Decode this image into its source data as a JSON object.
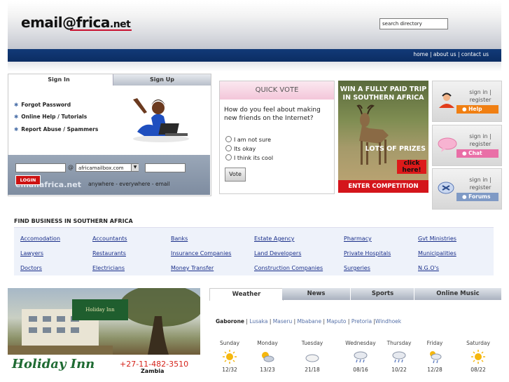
{
  "header": {
    "logo_main": "email@frica",
    "logo_tld": ".net",
    "search_value": "search directory",
    "nav": [
      "home",
      "about us",
      "contact us"
    ]
  },
  "signin": {
    "tab_signin": "Sign In",
    "tab_signup": "Sign Up",
    "links": [
      "Forgot Password",
      "Online Help / Tutorials",
      "Report Abuse / Spammers"
    ],
    "at_sign": "@",
    "domain": "africamailbox.com",
    "login_button": "LOGIN",
    "brand": "emailafrica.net",
    "tagline": "anywhere - everywhere - email"
  },
  "vote": {
    "title": "QUICK VOTE",
    "question": "How do you feel about making new friends on the Internet?",
    "options": [
      "I am not sure",
      "Its okay",
      "I think its cool"
    ],
    "button": "Vote"
  },
  "trip_ad": {
    "headline_1": "WIN A FULLY PAID TRIP",
    "headline_2": "IN SOUTHERN AFRICA",
    "prizes": "LOTS OF PRIZES",
    "click_1": "click",
    "click_2": "here!",
    "enter": "ENTER COMPETITION"
  },
  "sideboxes": [
    {
      "line1": "sign in |",
      "line2": "register",
      "tag": "Help",
      "tag_color": "#f07f12"
    },
    {
      "line1": "sign in |",
      "line2": "register",
      "tag": "Chat",
      "tag_color": "#e96fa7"
    },
    {
      "line1": "sign in |",
      "line2": "register",
      "tag": "Forums",
      "tag_color": "#7f9ac5"
    }
  ],
  "business": {
    "title": "FIND BUSINESS IN SOUTHERN AFRICA",
    "rows": [
      [
        "Accomodation",
        "Accountants",
        "Banks",
        "Estate Agency",
        "Pharmacy",
        "Gvt Ministries"
      ],
      [
        "Lawyers",
        "Restaurants",
        "Insurance Companies",
        "Land Developers",
        "Private Hospitals",
        "Municipalities"
      ],
      [
        "Doctors",
        "Electricians",
        "Money Transfer",
        "Construction Companies",
        "Surgeries",
        "N.G.O's"
      ]
    ]
  },
  "hotel_ad": {
    "name": "Holiday Inn",
    "phone": "+27-11-482-3510",
    "country": "Zambia",
    "sign": "Holiday Inn"
  },
  "weather": {
    "tabs": [
      "Weather",
      "News",
      "Sports",
      "Online Music"
    ],
    "selected_city": "Gaborone",
    "cities": [
      "Lusaka",
      "Maseru",
      "Mbabane",
      "Maputo",
      "Pretoria",
      "Windhoek"
    ],
    "days": [
      {
        "name": "Sunday",
        "icon": "sun-icon",
        "temp": "12/32"
      },
      {
        "name": "Monday",
        "icon": "sun-cloud-icon",
        "temp": "13/23"
      },
      {
        "name": "Tuesday",
        "icon": "cloud-icon",
        "temp": "21/18"
      },
      {
        "name": "Wednesday",
        "icon": "rain-icon",
        "temp": "08/16"
      },
      {
        "name": "Thursday",
        "icon": "rain-icon",
        "temp": "10/22"
      },
      {
        "name": "Friday",
        "icon": "sun-rain-icon",
        "temp": "12/28"
      },
      {
        "name": "Saturday",
        "icon": "sun-icon",
        "temp": "08/22"
      }
    ]
  }
}
